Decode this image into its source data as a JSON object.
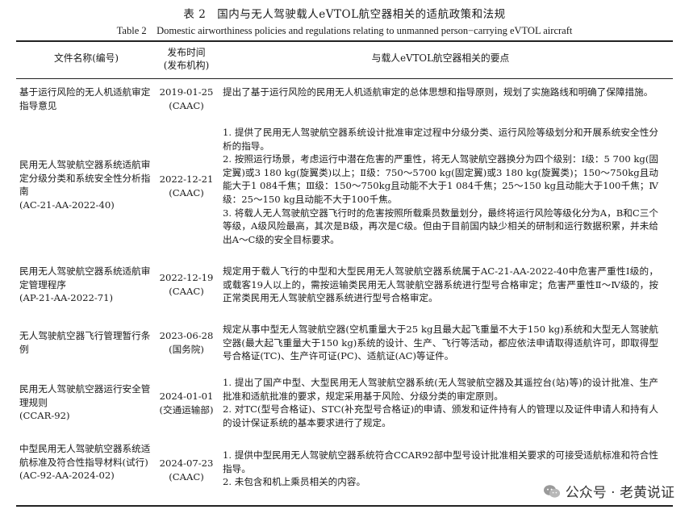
{
  "caption": {
    "cn": "表 2　国内与无人驾驶载人eVTOL航空器相关的适航政策和法规",
    "en": "Table 2　Domestic airworthiness policies and regulations relating to unmanned person−carrying eVTOL aircraft"
  },
  "headers": {
    "col1": "文件名称(编号)",
    "col2": "发布时间\n(发布机构)",
    "col3": "与载人eVTOL航空器相关的要点"
  },
  "rows": [
    {
      "name": "基于运行风险的无人机适航审定指导意见",
      "date": "2019-01-25\n(CAAC)",
      "points": [
        "提出了基于运行风险的民用无人机适航审定的总体思想和指导原则，规划了实施路线和明确了保障措施。"
      ]
    },
    {
      "name": "民用无人驾驶航空器系统适航审定分级分类和系统安全性分析指南\n(AC-21-AA-2022-40)",
      "date": "2022-12-21\n(CAAC)",
      "points": [
        "1. 提供了民用无人驾驶航空器系统设计批准审定过程中分级分类、运行风险等级划分和开展系统安全性分析的指导。",
        "2. 按照运行场景，考虑运行中潜在危害的严重性，将无人驾驶航空器换分为四个级别：Ⅰ级：5 700 kg(固定翼)或3 180 kg(旋翼类)以上；Ⅱ级：750～5700 kg(固定翼)或3 180 kg(旋翼类)；150～750kg且动能大于1 084千焦；Ⅲ级：150～750kg且动能不大于1 084千焦；25～150 kg且动能大于100千焦；Ⅳ级：25～150 kg且动能不大于100千焦。",
        "3. 将载人无人驾驶航空器飞行时的危害按照所载乘员数量划分，最终将运行风险等级化分为A，B和C三个等级，A级风险最高，其次是B级，再次是C级。但由于目前国内缺少相关的研制和运行数据积累，并未给出A～C级的安全目标要求。"
      ]
    },
    {
      "name": "民用无人驾驶航空器系统适航审定管理程序\n(AP-21-AA-2022-71)",
      "date": "2022-12-19\n(CAAC)",
      "points": [
        "规定用于载人飞行的中型和大型民用无人驾驶航空器系统属于AC-21-AA-2022-40中危害严重性Ⅰ级的，或载客19人以上的，需按运输类民用无人驾驶航空器系统进行型号合格审定；危害严重性Ⅱ～Ⅳ级的，按正常类民用无人驾驶航空器系统进行型号合格审定。"
      ]
    },
    {
      "name": "无人驾驶航空器飞行管理暂行条例",
      "date": "2023-06-28\n(国务院)",
      "points": [
        "规定从事中型无人驾驶航空器(空机重量大于25 kg且最大起飞重量不大于150 kg)系统和大型无人驾驶航空器(最大起飞重量大于150 kg)系统的设计、生产、飞行等活动，都应依法申请取得适航许可，即取得型号合格证(TC)、生产许可证(PC)、适航证(AC)等证件。"
      ]
    },
    {
      "name": "民用无人驾驶航空器运行安全管理规则\n(CCAR-92)",
      "date": "2024-01-01\n(交通运输部)",
      "points": [
        "1. 提出了国产中型、大型民用无人驾驶航空器系统(无人驾驶航空器及其遥控台(站)等)的设计批准、生产批准和适航批准的要求，规定采用基于风险、分级分类的审定原则。",
        "2. 对TC(型号合格证)、STC(补充型号合格证)的申请、颁发和证件持有人的管理以及证件申请人和持有人的设计保证系统的基本要求进行了规定。"
      ]
    },
    {
      "name": "中型民用无人驾驶航空器系统适航标准及符合性指导材料(试行)\n(AC-92-AA-2024-02)",
      "date": "2024-07-23\n(CAAC)",
      "points": [
        "1. 提供中型民用无人驾驶航空器系统符合CCAR92部中型号设计批准相关要求的可接受适航标准和符合性指导。",
        "2. 未包含和机上乘员相关的内容。"
      ]
    }
  ],
  "brand": {
    "icon": "wechat-icon",
    "text": "公众号 · 老黄说证"
  }
}
